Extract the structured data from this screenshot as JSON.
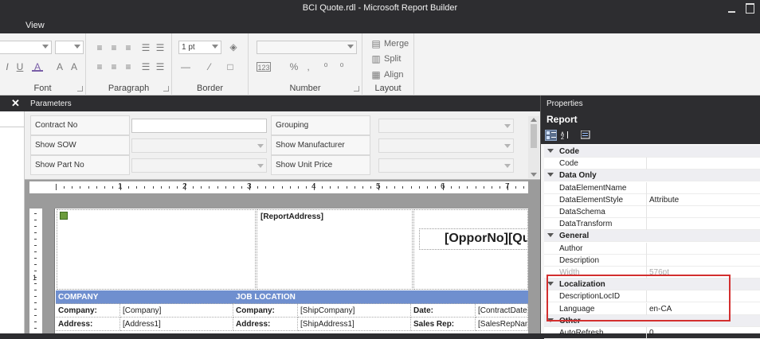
{
  "window": {
    "title": "BCI Quote.rdl - Microsoft Report Builder"
  },
  "menu": {
    "view_label": "View"
  },
  "ribbon": {
    "font": {
      "label": "Font",
      "underline_glyph": "U",
      "color_glyph": "A",
      "italic_glyph": "I"
    },
    "paragraph": {
      "label": "Paragraph"
    },
    "border": {
      "label": "Border",
      "width_value": "1 pt"
    },
    "number": {
      "label": "Number",
      "placeholder_glyph": "123"
    },
    "layout": {
      "label": "Layout",
      "merge_label": "Merge",
      "split_label": "Split",
      "align_label": "Align"
    }
  },
  "left_panel": {
    "close_glyph": "✕"
  },
  "parameters": {
    "header": "Parameters",
    "rows": [
      {
        "left_label": "Contract No",
        "right_label": "Grouping"
      },
      {
        "left_label": "Show SOW",
        "right_label": "Show Manufacturer"
      },
      {
        "left_label": "Show Part No",
        "right_label": "Show Unit Price"
      }
    ]
  },
  "ruler": {
    "numbers": [
      "1",
      "2",
      "3",
      "4",
      "5",
      "6",
      "7"
    ],
    "vnumbers": [
      "1"
    ]
  },
  "report": {
    "report_address": "[ReportAddress]",
    "title_field": "[OpporNo][Qu",
    "section_company": "COMPANY",
    "section_job": "JOB LOCATION",
    "rows": [
      {
        "c1": "Company:",
        "c2": "[Company]",
        "c3": "Company:",
        "c4": "[ShipCompany]",
        "c5": "Date:",
        "c6": "[ContractDate]"
      },
      {
        "c1": "Address:",
        "c2": "[Address1]",
        "c3": "Address:",
        "c4": "[ShipAddress1]",
        "c5": "Sales Rep:",
        "c6": "[SalesRepName"
      }
    ]
  },
  "properties": {
    "header": "Properties",
    "object": "Report",
    "rows": [
      {
        "type": "cat",
        "k": "Code"
      },
      {
        "type": "prop",
        "k": "Code",
        "v": ""
      },
      {
        "type": "cat",
        "k": "Data Only"
      },
      {
        "type": "prop",
        "k": "DataElementName",
        "v": ""
      },
      {
        "type": "prop",
        "k": "DataElementStyle",
        "v": "Attribute"
      },
      {
        "type": "prop",
        "k": "DataSchema",
        "v": ""
      },
      {
        "type": "prop",
        "k": "DataTransform",
        "v": ""
      },
      {
        "type": "cat",
        "k": "General"
      },
      {
        "type": "prop",
        "k": "Author",
        "v": ""
      },
      {
        "type": "prop",
        "k": "Description",
        "v": ""
      },
      {
        "type": "dim",
        "k": "Width",
        "v": "576pt"
      },
      {
        "type": "cat",
        "k": "Localization"
      },
      {
        "type": "prop",
        "k": "DescriptionLocID",
        "v": ""
      },
      {
        "type": "prop",
        "k": "Language",
        "v": "en-CA"
      },
      {
        "type": "cat",
        "k": "Other"
      },
      {
        "type": "prop",
        "k": "AutoRefresh",
        "v": "0"
      }
    ]
  },
  "colors": {
    "accent_bar": "#6f8fcf",
    "highlight_box": "#d32f2f",
    "chrome": "#2d2d30"
  }
}
